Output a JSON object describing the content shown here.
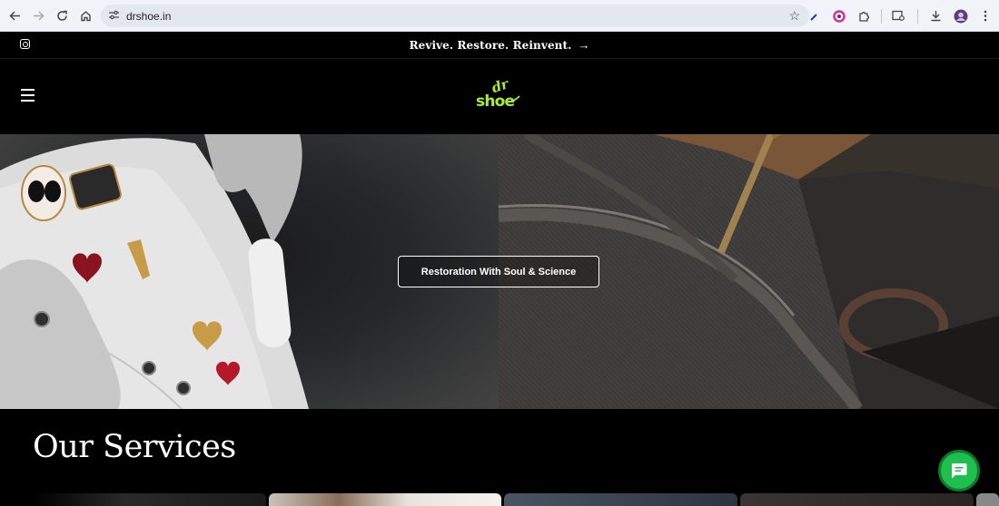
{
  "browser": {
    "url": "drshoe.in"
  },
  "announcement": {
    "text": "Revive. Restore. Reinvent.",
    "arrow": "→"
  },
  "header": {
    "logo_top": "dr",
    "logo_bottom": "shoe",
    "brand_color": "#a6f12c"
  },
  "hero": {
    "cta_label": "Restoration With Soul & Science"
  },
  "services": {
    "title": "Our Services"
  },
  "colors": {
    "chat_button": "#1fbf4f",
    "background": "#000000"
  }
}
